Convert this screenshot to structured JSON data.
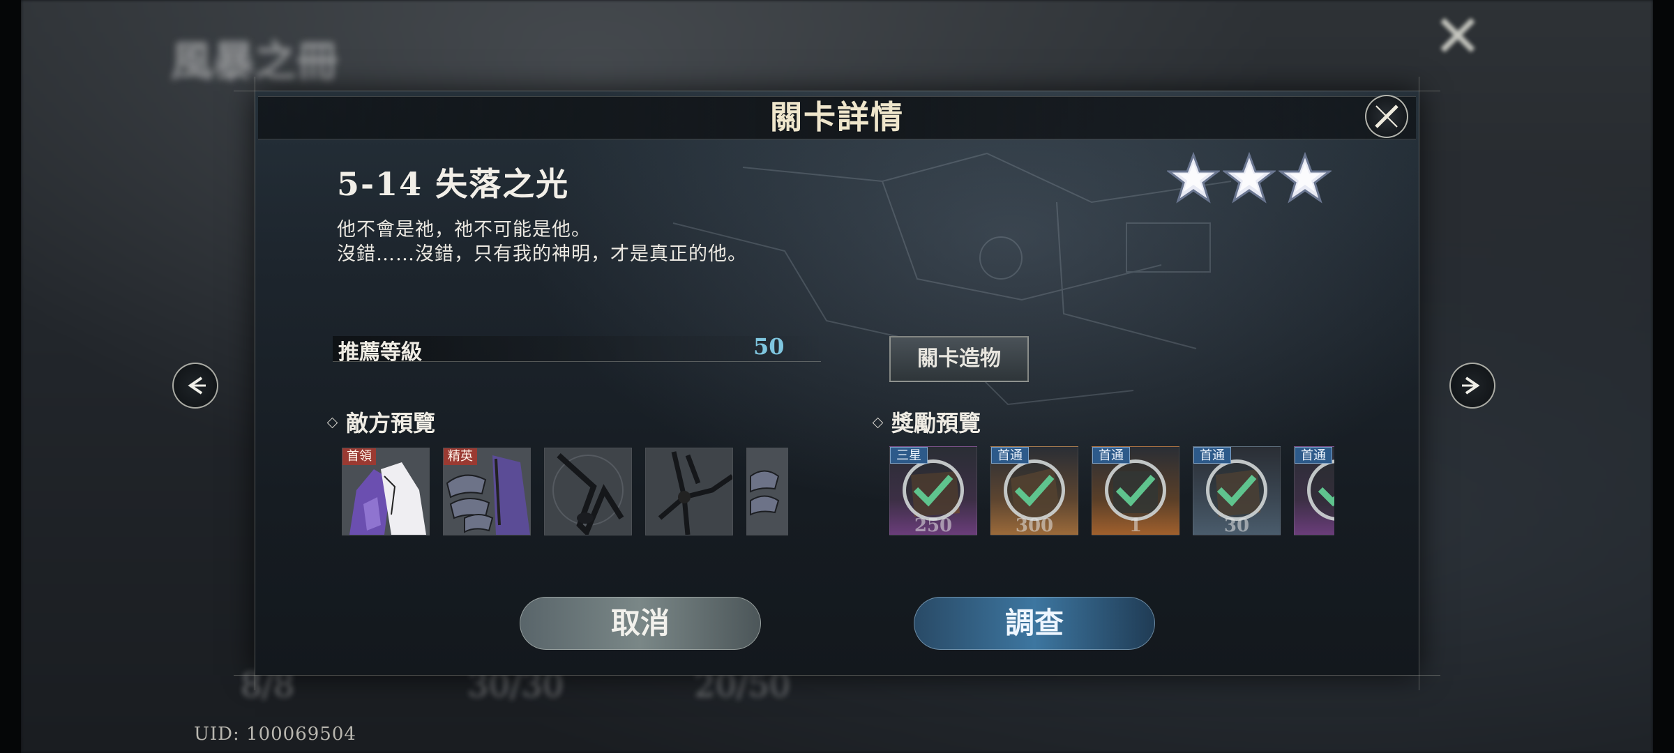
{
  "background": {
    "title": "風暴之冊",
    "uid": "UID: 100069504",
    "resources": [
      "8/8",
      "30/30",
      "20/50"
    ]
  },
  "dialog": {
    "title": "關卡詳情",
    "stage_title": "5-14 失落之光",
    "description": [
      "他不會是祂，祂不可能是他。",
      "沒錯……沒錯，只有我的神明，才是真正的他。"
    ],
    "stars_earned": 3,
    "stars_total": 3,
    "recommended_level_label": "推薦等級",
    "recommended_level_value": "50",
    "artifact_button": "關卡造物",
    "enemy_section": "敵方預覽",
    "reward_section": "獎勵預覽",
    "enemies": [
      {
        "tag": "首領",
        "icon": "purple-hooded-figure-icon"
      },
      {
        "tag": "精英",
        "icon": "serpent-heads-icon"
      },
      {
        "tag": "",
        "icon": "dark-tendril-icon"
      },
      {
        "tag": "",
        "icon": "dark-claw-icon"
      },
      {
        "tag": "",
        "icon": "serpent-head-icon"
      }
    ],
    "rewards": [
      {
        "tag": "三星",
        "qty": "250",
        "bg": "#6a3d7a",
        "claimed": true
      },
      {
        "tag": "首通",
        "qty": "300",
        "bg": "#9b6a3a",
        "claimed": true
      },
      {
        "tag": "首通",
        "qty": "1",
        "bg": "#a0602d",
        "claimed": true
      },
      {
        "tag": "首通",
        "qty": "30",
        "bg": "#4a5c6c",
        "claimed": true
      },
      {
        "tag": "首通",
        "qty": "",
        "bg": "#6a3d7a",
        "claimed": true
      }
    ],
    "cancel_button": "取消",
    "investigate_button": "調查"
  },
  "colors": {
    "accent_blue": "#7fc6df",
    "boss_tag": "#9a3a32",
    "reward_tag": "#2d5a8a",
    "check_green": "#5fc48e"
  }
}
